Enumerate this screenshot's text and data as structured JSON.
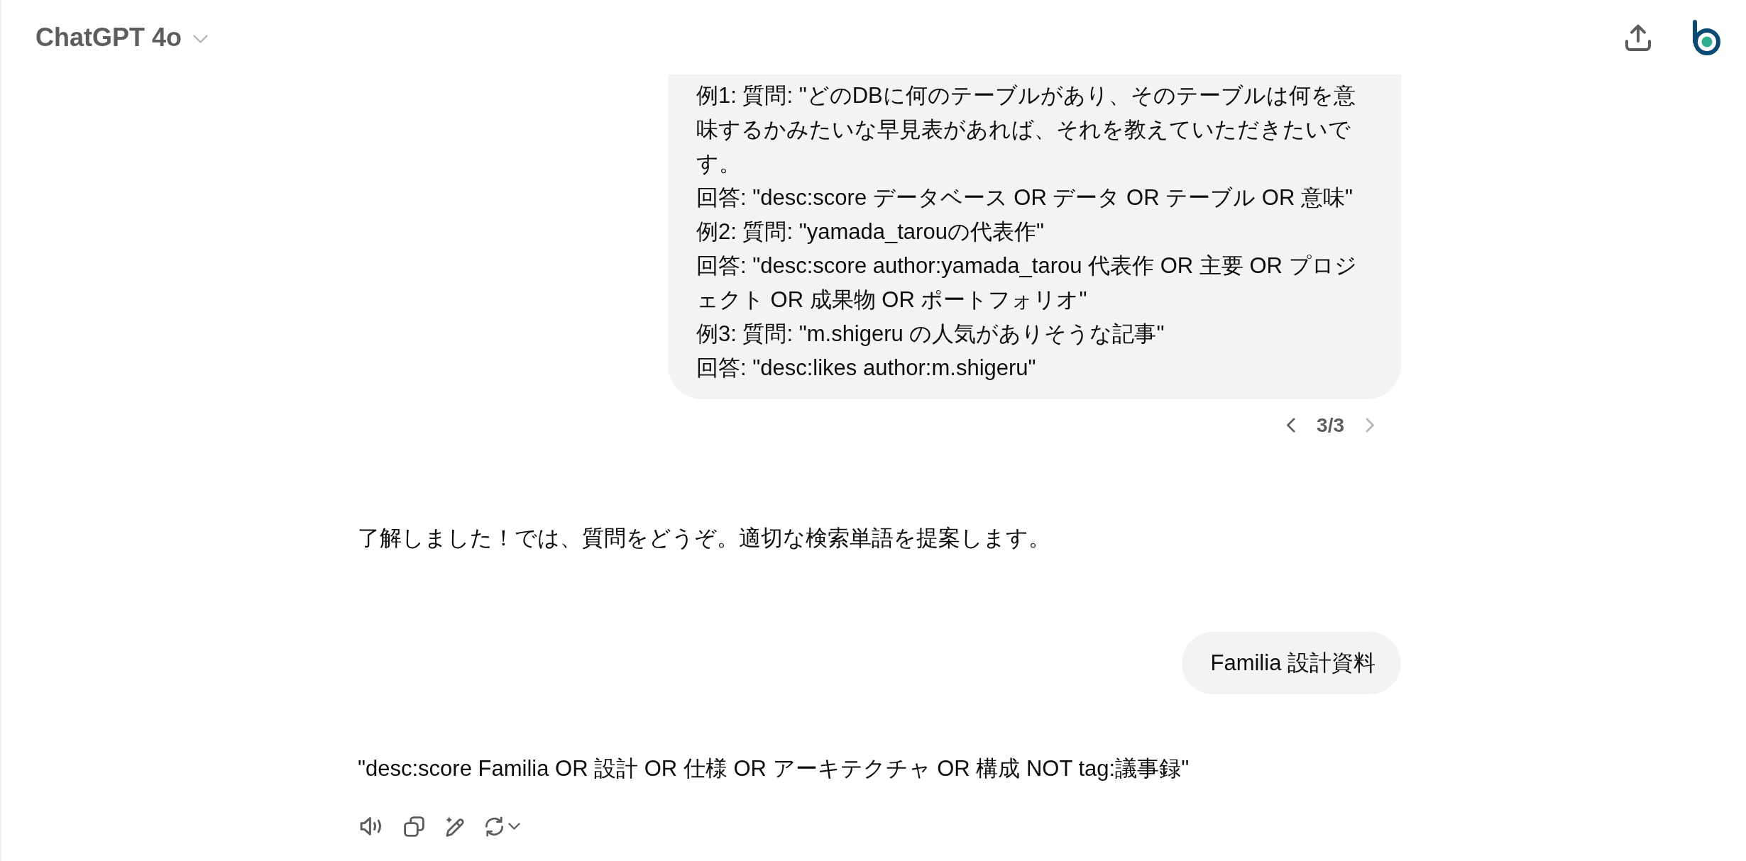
{
  "header": {
    "title": "ChatGPT 4o"
  },
  "messages": [
    {
      "kind": "user",
      "lines": [
        "例1: 質問: \"どのDBに何のテーブルがあり、そのテーブルは何を意味するかみたいな早見表があれば、それを教えていただきたいです。",
        "回答: \"desc:score データベース OR データ OR テーブル OR 意味\"",
        "例2: 質問: \"yamada_tarouの代表作\"",
        "回答: \"desc:score author:yamada_tarou 代表作 OR 主要 OR プロジェクト OR 成果物 OR ポートフォリオ\"",
        "例3: 質問: \"m.shigeru の人気がありそうな記事\"",
        "回答: \"desc:likes author:m.shigeru\""
      ],
      "pagination": {
        "label": "3/3",
        "prev_disabled": false,
        "next_disabled": true
      }
    },
    {
      "kind": "assistant",
      "text": "了解しました！では、質問をどうぞ。適切な検索単語を提案します。"
    },
    {
      "kind": "user",
      "lines": [
        "Familia 設計資料"
      ]
    },
    {
      "kind": "assistant",
      "text": "\"desc:score Familia OR 設計 OR 仕様 OR アーキテクチャ OR 構成 NOT tag:議事録\""
    }
  ]
}
